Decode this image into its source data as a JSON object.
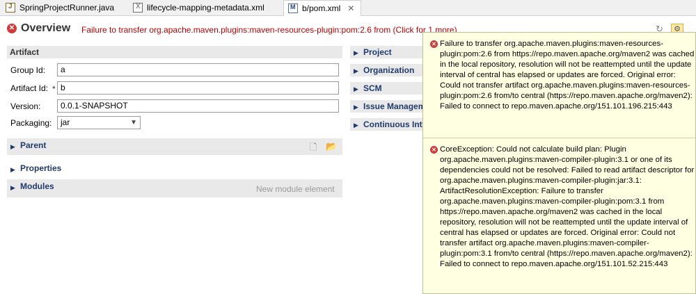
{
  "tabs": [
    {
      "label": "SpringProjectRunner.java",
      "icon": "java-file-icon"
    },
    {
      "label": "lifecycle-mapping-metadata.xml",
      "icon": "xml-file-icon"
    },
    {
      "label": "b/pom.xml",
      "icon": "pom-file-icon",
      "close": "✕"
    }
  ],
  "header": {
    "title": "Overview",
    "error_message": "Failure to transfer org.apache.maven.plugins:maven-resources-plugin:pom:2.6 from (Click for 1 more)"
  },
  "artifact": {
    "section_title": "Artifact",
    "group_id_label": "Group Id:",
    "group_id_value": "a",
    "artifact_id_label": "Artifact Id:",
    "artifact_id_value": "b",
    "required_marker": "*",
    "version_label": "Version:",
    "version_value": "0.0.1-SNAPSHOT",
    "packaging_label": "Packaging:",
    "packaging_value": "jar"
  },
  "left_sections": {
    "parent": "Parent",
    "properties": "Properties",
    "modules": "Modules",
    "new_module": "New module element"
  },
  "right_sections": [
    "Project",
    "Organization",
    "SCM",
    "Issue Managem",
    "Continuous Inte"
  ],
  "tooltip": {
    "errors": [
      "Failure to transfer org.apache.maven.plugins:maven-resources-plugin:pom:2.6 from https://repo.maven.apache.org/maven2 was cached in the local repository, resolution will not be reattempted until the update interval of central has elapsed or updates are forced. Original error: Could not transfer artifact org.apache.maven.plugins:maven-resources-plugin:pom:2.6 from/to central (https://repo.maven.apache.org/maven2): Failed to connect to repo.maven.apache.org/151.101.196.215:443",
      "CoreException: Could not calculate build plan: Plugin org.apache.maven.plugins:maven-compiler-plugin:3.1 or one of its dependencies could not be resolved: Failed to read artifact descriptor for org.apache.maven.plugins:maven-compiler-plugin:jar:3.1: ArtifactResolutionException: Failure to transfer org.apache.maven.plugins:maven-compiler-plugin:pom:3.1 from https://repo.maven.apache.org/maven2 was cached in the local repository, resolution will not be reattempted until the update interval of central has elapsed or updates are forced. Original error: Could not transfer artifact org.apache.maven.plugins:maven-compiler-plugin:pom:3.1 from/to central (https://repo.maven.apache.org/maven2): Failed to connect to repo.maven.apache.org/151.101.52.215:443"
    ]
  },
  "colors": {
    "error_red": "#c00000",
    "section_title": "#1f3a6b",
    "tooltip_bg": "#ffffe1"
  }
}
